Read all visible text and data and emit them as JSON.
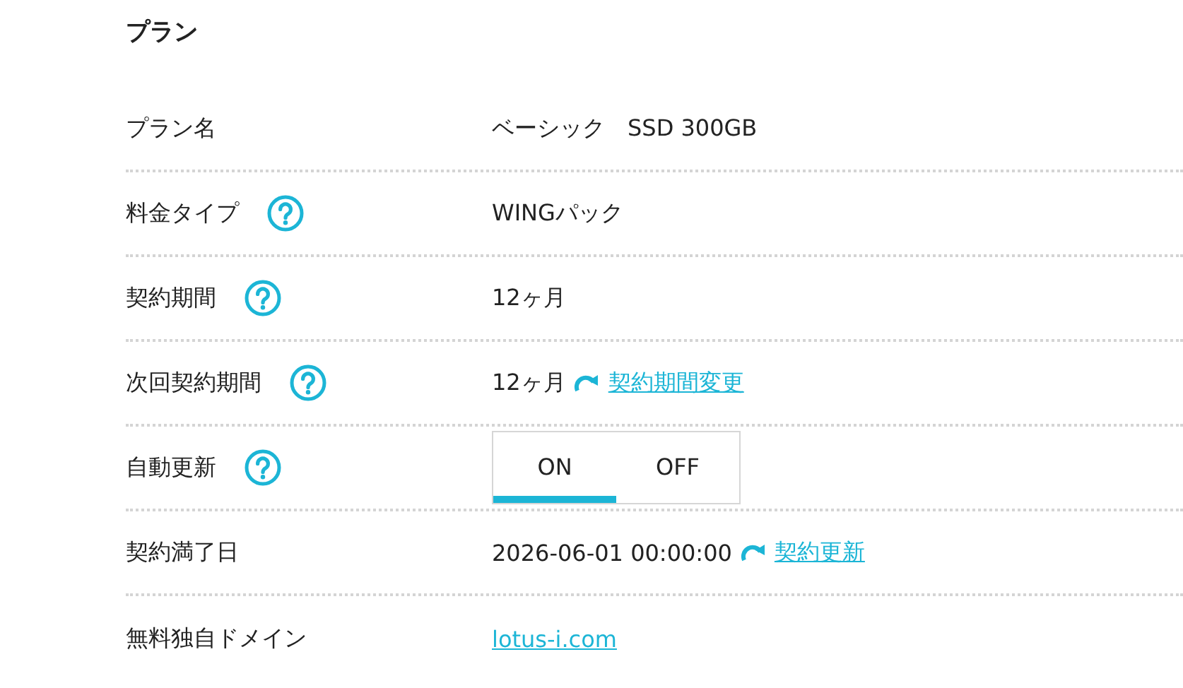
{
  "title": "プラン",
  "rows": [
    {
      "kind": "text",
      "label": "プラン名",
      "help": false,
      "value": "ベーシック　SSD 300GB"
    },
    {
      "kind": "text",
      "label": "料金タイプ",
      "help": true,
      "value": "WINGパック"
    },
    {
      "kind": "text",
      "label": "契約期間",
      "help": true,
      "value": "12ヶ月"
    },
    {
      "kind": "text",
      "label": "次回契約期間",
      "help": true,
      "value": "12ヶ月",
      "link": "契約期間変更"
    },
    {
      "kind": "toggle",
      "label": "自動更新",
      "help": true,
      "options": [
        {
          "label": "ON",
          "selected": true
        },
        {
          "label": "OFF",
          "selected": false
        }
      ]
    },
    {
      "kind": "text",
      "label": "契約満了日",
      "help": false,
      "value": "2026-06-01 00:00:00",
      "link": "契約更新"
    },
    {
      "kind": "link",
      "label": "無料独自ドメイン",
      "help": false,
      "value": "lotus-i.com"
    }
  ]
}
